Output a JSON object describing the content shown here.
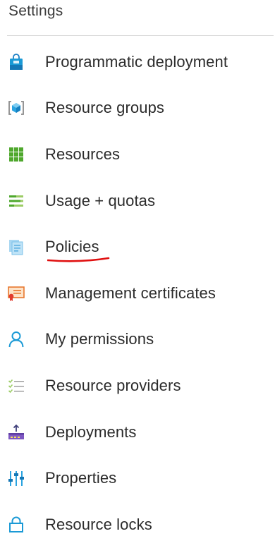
{
  "section": {
    "title": "Settings"
  },
  "menu": [
    {
      "label": "Programmatic deployment",
      "icon": "shopping-bag-icon"
    },
    {
      "label": "Resource groups",
      "icon": "resource-group-icon"
    },
    {
      "label": "Resources",
      "icon": "grid-icon"
    },
    {
      "label": "Usage + quotas",
      "icon": "usage-quota-icon"
    },
    {
      "label": "Policies",
      "icon": "policy-icon"
    },
    {
      "label": "Management certificates",
      "icon": "certificate-icon"
    },
    {
      "label": "My permissions",
      "icon": "person-icon"
    },
    {
      "label": "Resource providers",
      "icon": "checklist-icon"
    },
    {
      "label": "Deployments",
      "icon": "deployment-icon"
    },
    {
      "label": "Properties",
      "icon": "properties-icon"
    },
    {
      "label": "Resource locks",
      "icon": "lock-icon"
    }
  ],
  "colors": {
    "accent_blue": "#1b9ad6",
    "green": "#4fa82d",
    "underline_red": "#e01010"
  }
}
